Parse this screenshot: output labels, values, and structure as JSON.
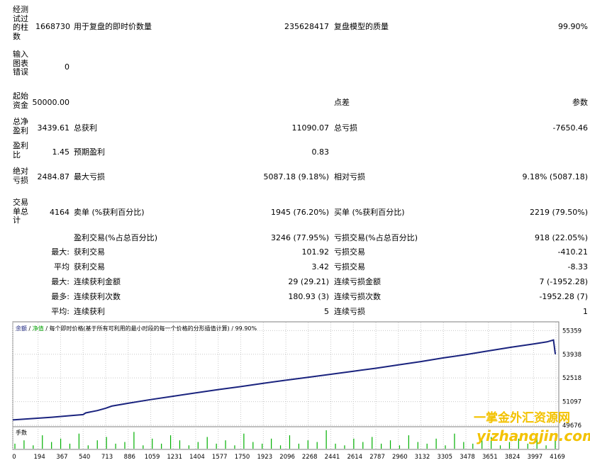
{
  "report": {
    "bars": {
      "label": "经测试过的柱数",
      "value": "1668730",
      "ticks_label": "用于复盘的即时价数量",
      "ticks_value": "235628417",
      "quality_label": "复盘模型的质量",
      "quality_value": "99.90%"
    },
    "errors": {
      "label": "输入图表错误",
      "value": "0"
    },
    "deposit": {
      "label": "起始资金",
      "value": "50000.00",
      "spread_label": "点差",
      "spread_value": "参数"
    },
    "net": {
      "label": "总净盈利",
      "value": "3439.61",
      "gp_label": "总获利",
      "gp_value": "11090.07",
      "gl_label": "总亏损",
      "gl_value": "-7650.46"
    },
    "pf": {
      "label": "盈利比",
      "value": "1.45",
      "ep_label": "预期盈利",
      "ep_value": "0.83"
    },
    "dd": {
      "label": "绝对亏损",
      "value": "2484.87",
      "max_label": "最大亏损",
      "max_value": "5087.18 (9.18%)",
      "rel_label": "相对亏损",
      "rel_value": "9.18% (5087.18)"
    },
    "trades": {
      "label": "交易单总计",
      "value": "4164",
      "short_label": "卖单 (%获利百分比)",
      "short_value": "1945 (76.20%)",
      "long_label": "买单 (%获利百分比)",
      "long_value": "2219 (79.50%)"
    },
    "profit_trades": {
      "label": "盈利交易(%占总百分比)",
      "value": "3246 (77.95%)",
      "loss_label": "亏损交易(%占总百分比)",
      "loss_value": "918 (22.05%)"
    },
    "largest": {
      "prefix": "最大:",
      "p_label": "获利交易",
      "p_value": "101.92",
      "l_label": "亏损交易",
      "l_value": "-410.21"
    },
    "average": {
      "prefix": "平均",
      "p_label": "获利交易",
      "p_value": "3.42",
      "l_label": "亏损交易",
      "l_value": "-8.33"
    },
    "max_cons": {
      "prefix": "最大:",
      "p_label": "连续获利金额",
      "p_value": "29 (29.21)",
      "l_label": "连续亏损金额",
      "l_value": "7 (-1952.28)"
    },
    "max_cons2": {
      "prefix": "最多:",
      "p_label": "连续获利次数",
      "p_value": "180.93 (3)",
      "l_label": "连续亏损次数",
      "l_value": "-1952.28 (7)"
    },
    "avg_cons": {
      "prefix": "平均:",
      "p_label": "连续获利",
      "p_value": "5",
      "l_label": "连续亏损",
      "l_value": "1"
    }
  },
  "chart_data": {
    "type": "line",
    "title": "余额 / 净值 / 每个即时价格(基于所有可利用的最小时段的每一个价格的分形插值计算) / 99.90%",
    "legend": {
      "balance": "余额",
      "equity": "净值",
      "description": "每个即时价格(基于所有可利用的最小时段的每一个价格的分形插值计算)",
      "quality": "99.90%"
    },
    "volume_label": "手数",
    "x_ticks": [
      0,
      194,
      367,
      540,
      713,
      886,
      1059,
      1231,
      1404,
      1577,
      1750,
      1923,
      2096,
      2268,
      2441,
      2614,
      2787,
      2960,
      3132,
      3305,
      3478,
      3651,
      3824,
      3997,
      4169
    ],
    "y_ticks": [
      49676,
      51097,
      52518,
      53938,
      55359
    ],
    "ylim": [
      49676,
      55800
    ],
    "xlim": [
      0,
      4180
    ],
    "series": [
      {
        "color": "#1a237e",
        "x": [
          0,
          150,
          300,
          450,
          540,
          560,
          650,
          713,
          760,
          886,
          1059,
          1231,
          1404,
          1577,
          1750,
          1923,
          2096,
          2268,
          2441,
          2614,
          2787,
          2960,
          3132,
          3305,
          3478,
          3651,
          3824,
          3997,
          4100,
          4150,
          4164
        ],
        "values": [
          50000,
          50080,
          50160,
          50260,
          50320,
          50420,
          50560,
          50700,
          50830,
          51000,
          51220,
          51420,
          51620,
          51820,
          52000,
          52200,
          52380,
          52560,
          52740,
          52920,
          53100,
          53300,
          53500,
          53720,
          53920,
          54140,
          54360,
          54560,
          54680,
          54790,
          53940
        ]
      }
    ],
    "volume_values": [
      3,
      5,
      2,
      8,
      4,
      6,
      3,
      9,
      2,
      5,
      7,
      3,
      4,
      10,
      2,
      6,
      3,
      8,
      5,
      2,
      4,
      7,
      3,
      5,
      2,
      9,
      4,
      3,
      6,
      2,
      8,
      3,
      5,
      4,
      11,
      3,
      2,
      6,
      4,
      7,
      3,
      5,
      2,
      8,
      4,
      3,
      6,
      2,
      9,
      4,
      3,
      5,
      7,
      2,
      4,
      6,
      3,
      8,
      2,
      5
    ]
  }
}
